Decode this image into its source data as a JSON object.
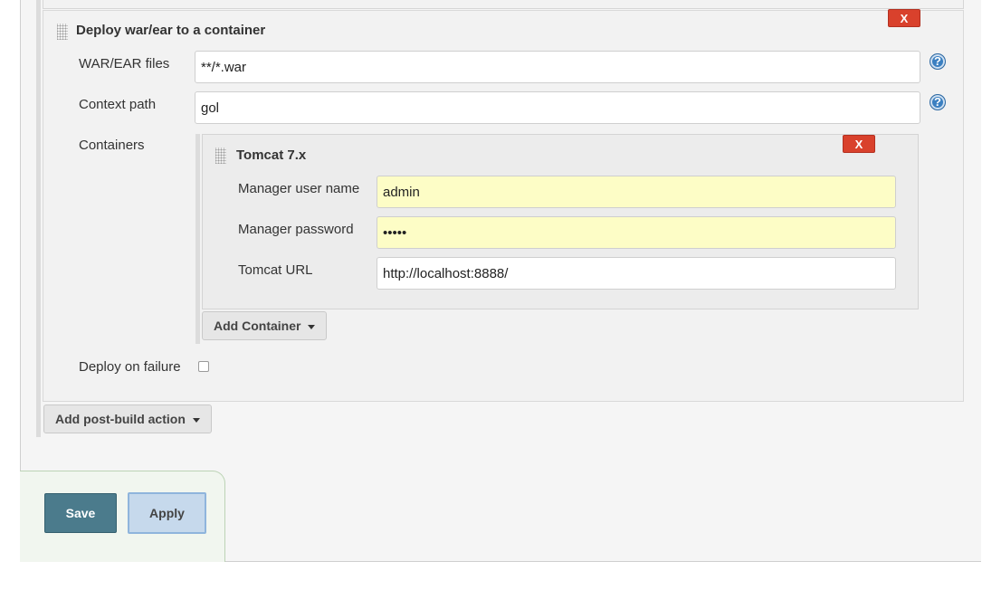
{
  "deploy_section": {
    "title": "Deploy war/ear to a container",
    "close_label": "X",
    "war_files": {
      "label": "WAR/EAR files",
      "value": "**/*.war"
    },
    "context_path": {
      "label": "Context path",
      "value": "gol"
    },
    "containers_label": "Containers",
    "help_glyph": "?"
  },
  "container": {
    "title": "Tomcat 7.x",
    "close_label": "X",
    "manager_user": {
      "label": "Manager user name",
      "value": "admin"
    },
    "manager_password": {
      "label": "Manager password",
      "value": "•••••"
    },
    "tomcat_url": {
      "label": "Tomcat URL",
      "value": "http://localhost:8888/"
    }
  },
  "add_container_label": "Add Container",
  "deploy_on_failure": {
    "label": "Deploy on failure",
    "checked": false
  },
  "add_post_build_label": "Add post-build action",
  "buttons": {
    "save": "Save",
    "apply": "Apply"
  },
  "colors": {
    "close_red": "#d9412c",
    "autofill_yellow": "#fdfdc6",
    "save_teal": "#4b7b8c",
    "apply_blue": "#c6d9ec",
    "help_blue": "#3a7fc1"
  }
}
